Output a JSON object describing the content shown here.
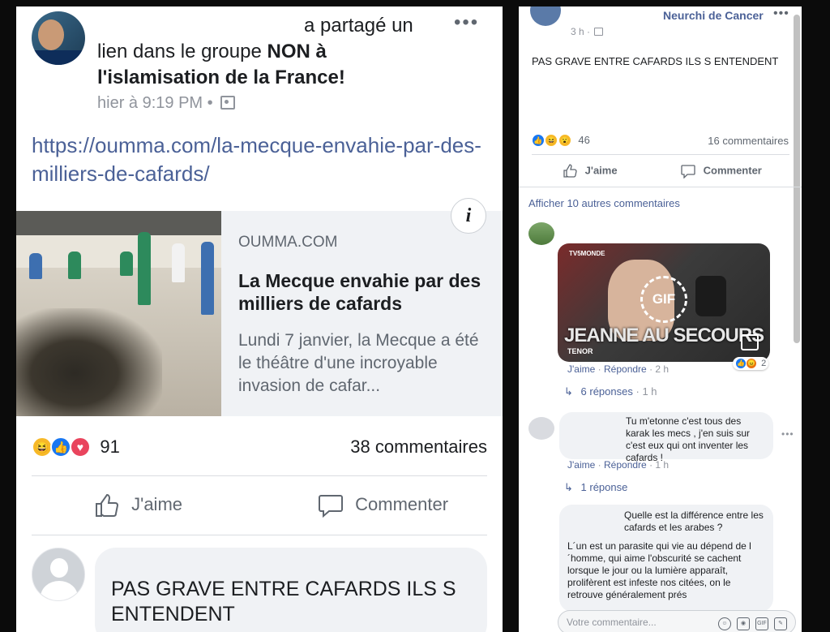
{
  "left_post": {
    "header_prefix": "a partagé un lien dans le groupe ",
    "group_name": "NON à l'islamisation de la France!",
    "timestamp": "hier à 9:19 PM",
    "separator": "•",
    "link_url": "https://oumma.com/la-mecque-envahie-par-des-milliers-de-cafards/",
    "card": {
      "domain": "OUMMA.COM",
      "title": "La Mecque envahie par des milliers de cafards",
      "description": "Lundi 7 janvier, la Mecque a été le théâtre d'une incroyable invasion de cafar..."
    },
    "reaction_count": "91",
    "comment_count": "38 commentaires",
    "like_label": "J'aime",
    "comment_label": "Commenter",
    "comment_text": "PAS GRAVE ENTRE CAFARDS ILS S ENTENDENT",
    "more_glyph": "•••"
  },
  "right_post": {
    "group_name": "Neurchi de Cancer",
    "more_glyph": "•••",
    "timestamp": "3 h ·",
    "post_text": "PAS GRAVE ENTRE CAFARDS ILS S ENTENDENT",
    "reaction_count": "46",
    "comment_count": "16 commentaires",
    "like_label": "J'aime",
    "comment_label": "Commenter",
    "show_more": "Afficher 10 autres commentaires",
    "gif": {
      "badge": "GIF",
      "caption": "JEANNE AU SECOURS",
      "source": "TENOR",
      "channel": "TV5MONDE",
      "reaction_count": "2"
    },
    "comments": [
      {
        "actions": {
          "like": "J'aime",
          "reply": "Répondre",
          "time": "2 h"
        },
        "replies": "6 réponses",
        "replies_time": "1 h"
      },
      {
        "text": "Tu m'etonne c'est tous des karak les mecs , j'en suis sur c'est eux qui ont inventer les cafards !",
        "actions": {
          "like": "J'aime",
          "reply": "Répondre",
          "time": "1 h"
        },
        "replies": "1 réponse"
      },
      {
        "text": "Quelle est la différence entre les cafards et les arabes ?",
        "text2": "L´un est un parasite qui vie au dépend de l´homme, qui aime l'obscurité se cachent lorsque le jour ou la lumière apparaît, prolifèrent est infeste nos citées, on le retrouve généralement prés"
      }
    ],
    "composer_placeholder": "Votre commentaire..."
  }
}
